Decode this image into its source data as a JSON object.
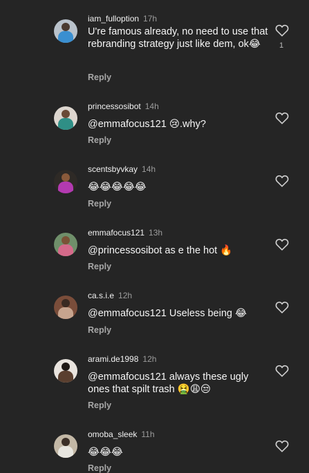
{
  "comments": [
    {
      "username": "iam_fulloption",
      "time": "17h",
      "text": "U're famous already, no need to use that rebranding strategy just like dem, ok😂",
      "reply": "Reply",
      "likes": "1"
    },
    {
      "username": "princessosibot",
      "time": "14h",
      "text": "@emmafocus121 😢.why?",
      "reply": "Reply"
    },
    {
      "username": "scentsbyvkay",
      "time": "14h",
      "text": "😂😂😂😂😂",
      "reply": "Reply"
    },
    {
      "username": "emmafocus121",
      "time": "13h",
      "text": "@princessosibot as e the hot 🔥",
      "reply": "Reply"
    },
    {
      "username": "ca.s.i.e",
      "time": "12h",
      "text": "@emmafocus121 Useless being 😂",
      "reply": "Reply"
    },
    {
      "username": "arami.de1998",
      "time": "12h",
      "text": "@emmafocus121 always these ugly ones that spilt trash 🤮😩😒",
      "reply": "Reply"
    },
    {
      "username": "omoba_sleek",
      "time": "11h",
      "text": "😂😂😂",
      "reply": "Reply"
    }
  ],
  "avatar_colors": [
    {
      "bg": "#b9c2cb",
      "head": "#4a3a30",
      "body": "#3a8fd0"
    },
    {
      "bg": "#ddd6cf",
      "head": "#6a4a36",
      "body": "#2f8f86"
    },
    {
      "bg": "#2e2a26",
      "head": "#8a5a3a",
      "body": "#b33ab0"
    },
    {
      "bg": "#6f8f6a",
      "head": "#7a5236",
      "body": "#d46a8a"
    },
    {
      "bg": "#7a4d3a",
      "head": "#3a2a22",
      "body": "#c7a48e"
    },
    {
      "bg": "#e9e4de",
      "head": "#1f1915",
      "body": "#5a3f2f"
    },
    {
      "bg": "#c3b8a6",
      "head": "#3b2f27",
      "body": "#e8e6e0"
    }
  ]
}
